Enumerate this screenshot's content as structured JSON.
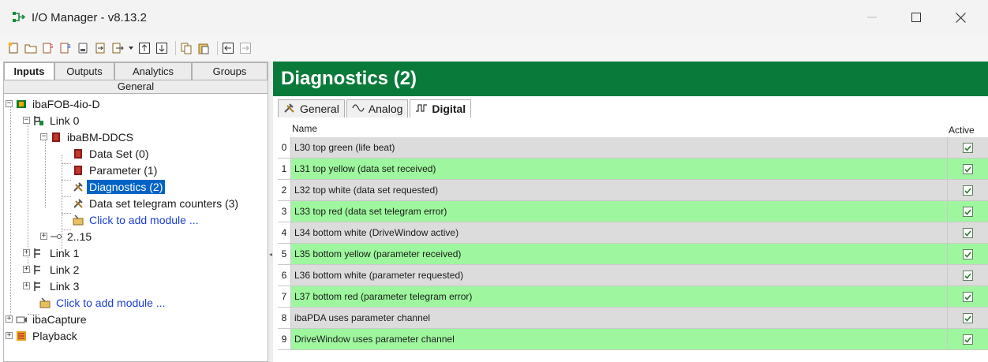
{
  "window": {
    "title": "I/O Manager - v8.13.2"
  },
  "left_panel": {
    "tabs": [
      "Inputs",
      "Outputs",
      "Analytics",
      "Groups"
    ],
    "subtab": "General",
    "tree": {
      "root": "ibaFOB-4io-D",
      "link0": "Link 0",
      "module": "ibaBM-DDCS",
      "data_set": "Data Set (0)",
      "parameter": "Parameter (1)",
      "diagnostics": "Diagnostics (2)",
      "telegram_counters": "Data set telegram counters (3)",
      "add_module_inner": "Click to add module ...",
      "range": "2..15",
      "link1": "Link 1",
      "link2": "Link 2",
      "link3": "Link 3",
      "add_module_outer": "Click to add module ...",
      "capture": "ibaCapture",
      "playback": "Playback"
    }
  },
  "right_panel": {
    "title": "Diagnostics (2)",
    "tabs": [
      "General",
      "Analog",
      "Digital"
    ],
    "columns": {
      "name": "Name",
      "active": "Active"
    },
    "rows": [
      {
        "index": "0",
        "name": "L30 top green (life beat)",
        "active": true,
        "green": false
      },
      {
        "index": "1",
        "name": "L31 top yellow (data set received)",
        "active": true,
        "green": true
      },
      {
        "index": "2",
        "name": "L32 top white (data set requested)",
        "active": true,
        "green": false
      },
      {
        "index": "3",
        "name": "L33 top red  (data set telegram error)",
        "active": true,
        "green": true
      },
      {
        "index": "4",
        "name": "L34 bottom white (DriveWindow active)",
        "active": true,
        "green": false
      },
      {
        "index": "5",
        "name": "L35 bottom yellow (parameter received)",
        "active": true,
        "green": true
      },
      {
        "index": "6",
        "name": "L36 bottom white (parameter requested)",
        "active": true,
        "green": false
      },
      {
        "index": "7",
        "name": "L37 bottom red (parameter telegram error)",
        "active": true,
        "green": true
      },
      {
        "index": "8",
        "name": "ibaPDA uses parameter channel",
        "active": true,
        "green": false
      },
      {
        "index": "9",
        "name": "DriveWindow uses parameter channel",
        "active": true,
        "green": true
      }
    ]
  },
  "colors": {
    "banner": "#0a7a3a",
    "green_row": "#9ef79e",
    "grey_row": "#dcdcdc",
    "selection": "#0063c6"
  },
  "icons": {
    "toolbar": [
      "new-icon",
      "open-icon",
      "import-icon",
      "export-icon",
      "save-icon",
      "arrow-in-icon",
      "arrow-out-icon",
      "move-up-icon",
      "move-down-icon",
      "copy-icon",
      "paste-icon",
      "collapse-icon",
      "expand-icon"
    ]
  }
}
